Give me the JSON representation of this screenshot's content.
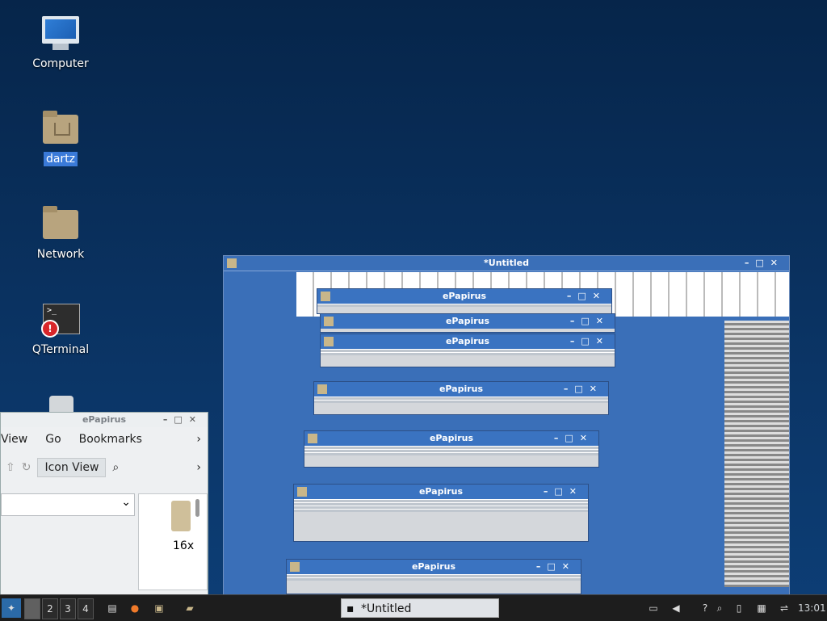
{
  "desktop": {
    "icons": [
      {
        "label": "Computer"
      },
      {
        "label": "dartz"
      },
      {
        "label": "Network"
      },
      {
        "label": "QTerminal"
      }
    ]
  },
  "main_window": {
    "title": "*Untitled"
  },
  "stacked_window_title": "ePapirus",
  "file_manager": {
    "title": "ePapirus",
    "menu": [
      "View",
      "Go",
      "Bookmarks"
    ],
    "view_mode": "Icon View",
    "item_label": "16x"
  },
  "taskbar": {
    "workspaces": [
      "2",
      "3",
      "4"
    ],
    "task_title": "*Untitled",
    "clock": "13:01"
  }
}
